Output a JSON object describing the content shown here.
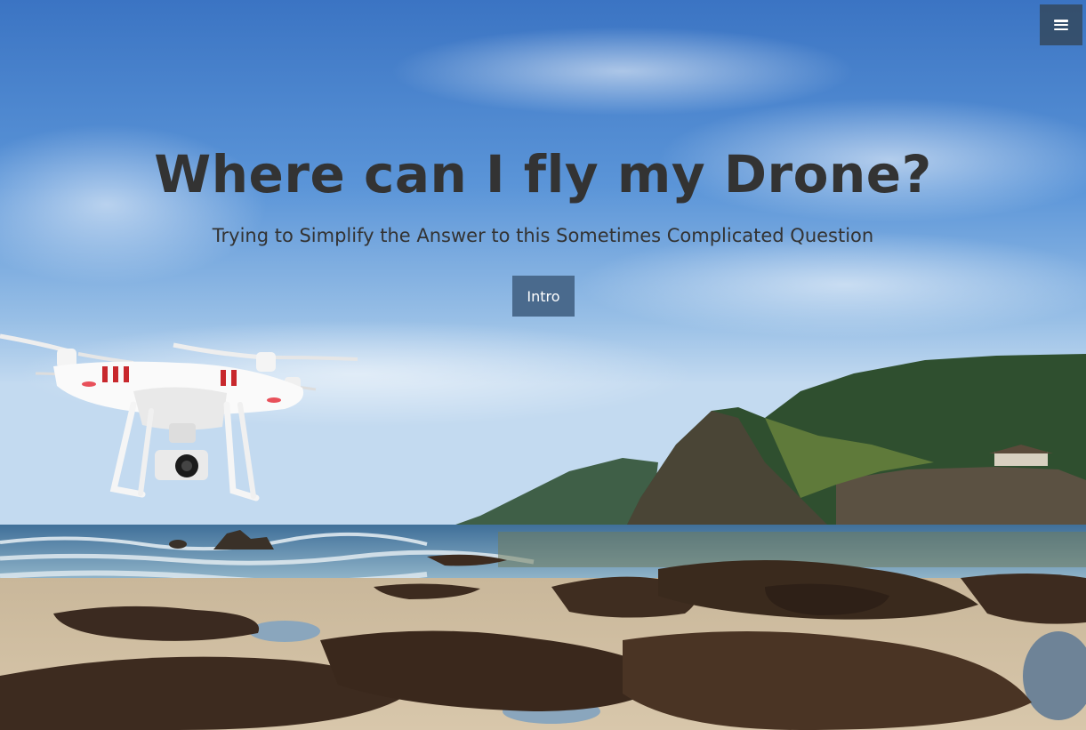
{
  "hero": {
    "title": "Where can I fly my Drone?",
    "subtitle": "Trying to Simplify the Answer to this Sometimes Complicated Question",
    "cta_label": "Intro"
  },
  "nav": {
    "menu_icon": "hamburger-menu-icon"
  },
  "colors": {
    "text": "#333333",
    "button_bg": "#4a6a8d",
    "menu_bg": "#34495e"
  }
}
